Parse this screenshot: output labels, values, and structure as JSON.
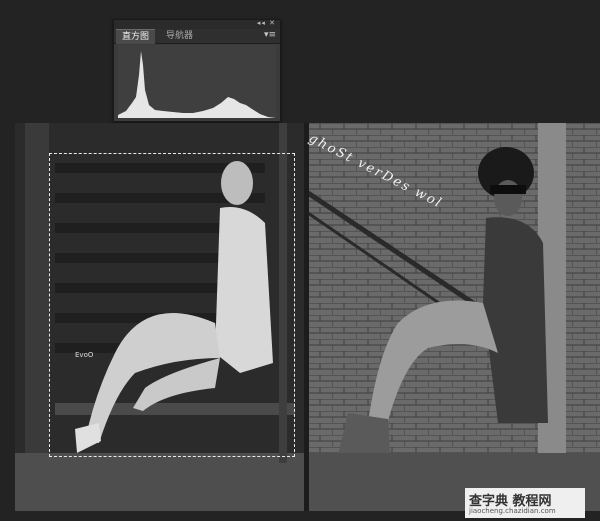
{
  "histogram_panel": {
    "tab_active": "直方图",
    "tab_inactive": "导航器",
    "controls": "◂◂ ✕",
    "menu": "▾≡"
  },
  "photo": {
    "script_text": "ghoSt verDes wol",
    "small_text": "EvoO"
  },
  "badge": {
    "title": "查字典 教程网",
    "subtitle": "jiaocheng.chazidian.com"
  }
}
